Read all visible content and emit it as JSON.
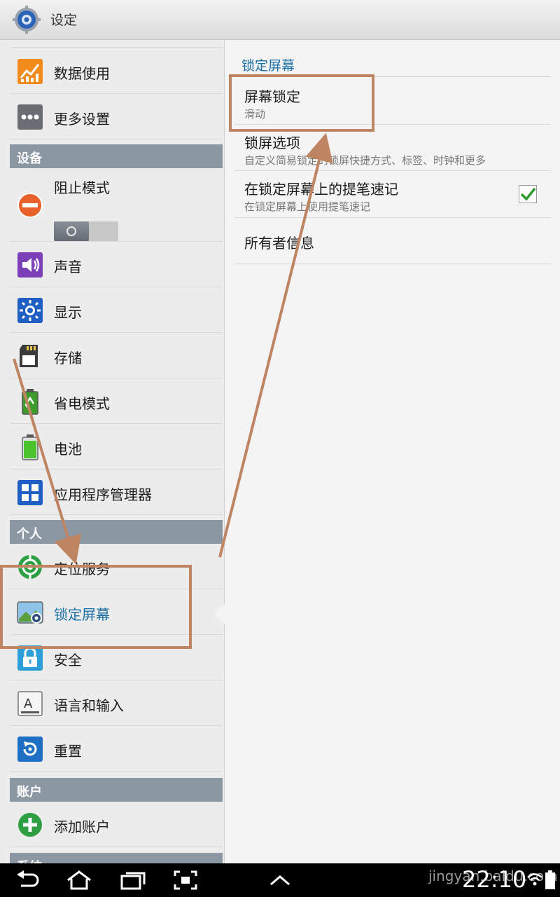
{
  "app": {
    "title": "设定"
  },
  "left_panel": {
    "items": [
      {
        "label": "数据使用",
        "icon": "data-usage-icon"
      },
      {
        "label": "更多设置",
        "icon": "more-settings-icon"
      }
    ],
    "sections": {
      "device": "设备",
      "personal": "个人",
      "accounts": "账户",
      "system": "系统"
    },
    "blocking_mode": {
      "label": "阻止模式",
      "icon": "blocking-mode-icon",
      "toggle_state": "off"
    },
    "device_items": [
      {
        "label": "声音",
        "icon": "sound-icon"
      },
      {
        "label": "显示",
        "icon": "display-icon"
      },
      {
        "label": "存储",
        "icon": "storage-icon"
      },
      {
        "label": "省电模式",
        "icon": "power-saving-icon"
      },
      {
        "label": "电池",
        "icon": "battery-icon"
      },
      {
        "label": "应用程序管理器",
        "icon": "app-manager-icon"
      }
    ],
    "personal_items": [
      {
        "label": "定位服务",
        "icon": "location-icon"
      },
      {
        "label": "锁定屏幕",
        "icon": "lock-screen-icon",
        "selected": true
      },
      {
        "label": "安全",
        "icon": "security-icon"
      },
      {
        "label": "语言和输入",
        "icon": "language-icon"
      },
      {
        "label": "重置",
        "icon": "reset-icon"
      }
    ],
    "account_items": [
      {
        "label": "添加账户",
        "icon": "add-account-icon"
      }
    ]
  },
  "right_panel": {
    "header": "锁定屏幕",
    "prefs": [
      {
        "title": "屏幕锁定",
        "summary": "滑动"
      },
      {
        "title": "锁屏选项",
        "summary": "自定义简易锁定的锁屏快捷方式、标签、时钟和更多"
      },
      {
        "title": "在锁定屏幕上的提笔速记",
        "summary": "在锁定屏幕上使用提笔速记",
        "checked": true
      },
      {
        "title": "所有者信息"
      }
    ]
  },
  "status": {
    "time": "22:10",
    "watermark": "jingyan.baidu.com"
  },
  "colors": {
    "accent": "#1b6fa5",
    "section": "#8b97a3",
    "annotation": "#bf8462"
  }
}
